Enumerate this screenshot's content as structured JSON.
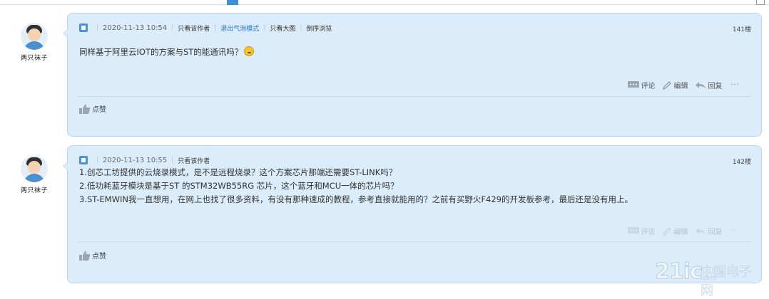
{
  "posts": [
    {
      "author": "两只袜子",
      "date": "2020-11-13 10:54",
      "meta_links": [
        "只看该作者",
        "退出气泡模式",
        "只看大图",
        "倒序浏览"
      ],
      "floor": "141楼",
      "content_lines": [
        "同样基于阿里云IOT的方案与ST的能通讯吗？"
      ],
      "actions": {
        "comment": "评论",
        "edit": "编辑",
        "reply": "回复",
        "more": "···"
      },
      "like": "点赞"
    },
    {
      "author": "两只袜子",
      "date": "2020-11-13 10:55",
      "meta_links": [
        "只看该作者"
      ],
      "floor": "142楼",
      "content_lines": [
        "1.创芯工坊提供的云烧录模式，是不是远程烧录？这个方案芯片那端还需要ST-LINK吗？",
        "2.低功耗蓝牙模块是基于ST 的STM32WB55RG 芯片，这个蓝牙和MCU一体的芯片吗？",
        "3.ST-EMWIN我一直想用，在网上也找了很多资料，有没有那种速成的教程，参考直接就能用的？之前有买野火F429的开发板参考，最后还是没有用上。"
      ],
      "actions": {
        "comment": "评论",
        "edit": "编辑",
        "reply": "回复",
        "more": "···"
      },
      "like": "点赞"
    }
  ],
  "watermark": {
    "number": "21ic",
    "name": "中国电子网",
    "domain": ".com"
  },
  "colors": {
    "bubble_bg": "#dbecfa",
    "bubble_border": "#b9d6ee",
    "link_blue": "#2b74c4",
    "accent": "#3a8fd8"
  }
}
